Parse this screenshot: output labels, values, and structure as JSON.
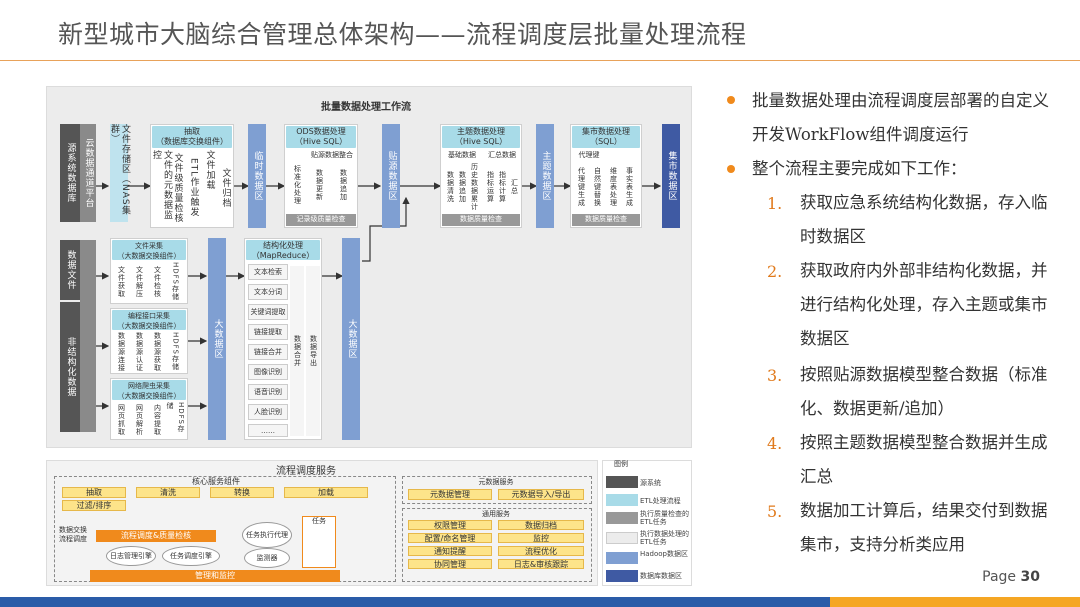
{
  "title": "新型城市大脑综合管理总体架构——流程调度层批量处理流程",
  "diagram": {
    "workflow_title": "批量数据处理工作流",
    "sources_struct": "源系统数据库",
    "cloud_channel": "云数据通道平台",
    "file_store": "文件存储区（NAS集群）",
    "extract_hdr": "抽取\n（数据库交换组件）",
    "extract_items": [
      "文件的元数据监控",
      "文件级质量检核",
      "ETL作业触发",
      "文件加载",
      "文件归档"
    ],
    "temp_zone": "临时数据区",
    "ods_hdr": "ODS数据处理\n（Hive SQL）",
    "ods_sub": "贴源数据整合",
    "ods_items": [
      "标准化处理",
      "数据更新",
      "数据追加"
    ],
    "ods_check": "记录级质量检查",
    "paste_zone": "贴源数据区",
    "theme_hdr": "主题数据处理\n（Hive SQL）",
    "theme_sub1": "基础数据",
    "theme_sub2": "汇总数据",
    "theme_items": [
      "数据清洗",
      "数据追加",
      "历史数据累计",
      "指标运算",
      "指标计算",
      "汇总"
    ],
    "theme_check": "数据质量检查",
    "theme_zone": "主题数据区",
    "mart_hdr": "集市数据处理\n（SQL）",
    "mart_sub": "代理键",
    "mart_items": [
      "代理键生成",
      "自然键替换",
      "维度表处理",
      "事实表生成"
    ],
    "mart_check": "数据质量检查",
    "mart_zone": "集市数据区",
    "data_file": "数据文件",
    "unstruct": "非结构化数据",
    "fc_hdr": "文件采集\n（大数据交换组件）",
    "fc_items": [
      "文件获取",
      "文件解压",
      "文件检核",
      "HDFS存储"
    ],
    "api_hdr": "编程接口采集\n（大数据交换组件）",
    "api_items": [
      "数据源连接",
      "数据源认证",
      "数据源获取",
      "HDFS存储"
    ],
    "crawl_hdr": "网络爬虫采集\n（大数据交换组件）",
    "crawl_items": [
      "网页抓取",
      "网页解析",
      "内容提取",
      "HDFS存储"
    ],
    "bigdata_zone": "大数据区",
    "mr_hdr": "结构化处理\n（MapReduce）",
    "mr_items": [
      "文本检索",
      "文本分词",
      "关键词提取",
      "链接提取",
      "链接合并",
      "图像识别",
      "语音识别",
      "人脸识别",
      "……"
    ],
    "mr_merge": "数据合并",
    "mr_export": "数据导出",
    "bigdata_zone2": "大数据区",
    "sched_title": "流程调度服务",
    "core_title": "核心服务组件",
    "core_row": [
      "抽取",
      "清洗",
      "转换",
      "加载"
    ],
    "core_sort": "过滤/排序",
    "core_side": "数据交换流程调度",
    "core_qc": "流程调度&质量检核",
    "core_log": "日志管理引擎",
    "core_engine": "任务调度引擎",
    "core_exec": "任务执行代理",
    "core_mon": "监测器",
    "core_task": "任务",
    "core_bottom": "管理和监控",
    "meta_title": "元数据服务",
    "meta_items": [
      "元数据管理",
      "元数据导入/导出"
    ],
    "common_title": "通用服务",
    "common_items": [
      "权限管理",
      "数据归档",
      "配置/命名管理",
      "监控",
      "通知提醒",
      "流程优化",
      "协同管理",
      "日志&审核跟踪"
    ],
    "legend_title": "图例",
    "legend": [
      "源系统",
      "ETL处理流程",
      "执行质量检查的ETL任务",
      "执行数据处理的ETL任务",
      "Hadoop数据区",
      "数据库数据区"
    ]
  },
  "bullets": {
    "b1": "批量数据处理由流程调度层部署的自定义开发WorkFlow组件调度运行",
    "b2": "整个流程主要完成如下工作：",
    "items": [
      {
        "n": "1.",
        "t": "获取应急系统结构化数据，存入临时数据区"
      },
      {
        "n": "2.",
        "t": "获取政府内外部非结构化数据，并进行结构化处理，存入主题或集市数据区"
      },
      {
        "n": "3.",
        "t": "按照贴源数据模型整合数据（标准化、数据更新/追加）"
      },
      {
        "n": "4.",
        "t": "按照主题数据模型整合数据并生成汇总"
      },
      {
        "n": "5.",
        "t": "数据加工计算后，结果交付到数据集市，支持分析类应用"
      }
    ]
  },
  "page_label": "Page",
  "page_num": "30",
  "colors": {
    "accent": "#f08a1c",
    "footer_blue": "#2a5ca8",
    "footer_orange": "#f5a623",
    "zone_blue": "#7f9fd2",
    "header_cyan": "#a8dbe8"
  }
}
